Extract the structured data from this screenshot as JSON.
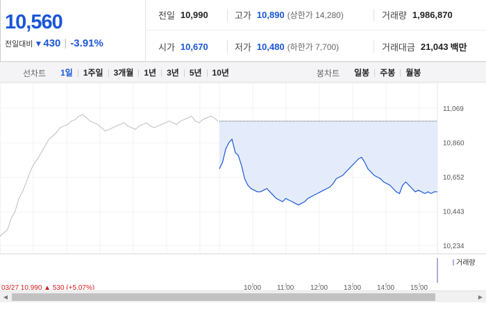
{
  "summary": {
    "price": "10,560",
    "change_label": "전일대비",
    "change_direction_icon": "down-triangle-icon",
    "change_value": "430",
    "change_percent": "-3.91%",
    "stats": {
      "prev_close": {
        "label": "전일",
        "value": "10,990"
      },
      "high": {
        "label": "고가",
        "value": "10,890",
        "sub": "(상한가 14,280)"
      },
      "volume": {
        "label": "거래량",
        "value": "1,986,870"
      },
      "open": {
        "label": "시가",
        "value": "10,670"
      },
      "low": {
        "label": "저가",
        "value": "10,480",
        "sub": "(하한가 7,700)"
      },
      "amount": {
        "label": "거래대금",
        "value": "21,043",
        "unit": "백만"
      }
    }
  },
  "toolbar": {
    "line_chart": {
      "title": "선차트",
      "items": [
        "1일",
        "1주일",
        "3개월",
        "1년",
        "3년",
        "5년",
        "10년"
      ],
      "active": 0
    },
    "candle_chart": {
      "title": "봉차트",
      "items": [
        "일봉",
        "주봉",
        "월봉"
      ]
    }
  },
  "colors": {
    "up": "#d61c1c",
    "down": "#1a56d6",
    "prev_line": "#bdbdbd",
    "fill": "#e4ecfb",
    "line": "#1a56d6"
  },
  "chart_data": {
    "type": "line",
    "y_ticks": [
      "11,069",
      "10,860",
      "10,652",
      "10,443",
      "10,234"
    ],
    "ylim": [
      10234,
      11069
    ],
    "volume_legend": "거래량",
    "x_ticks": [
      "10:00",
      "11:00",
      "12:00",
      "13:00",
      "14:00",
      "15:00"
    ],
    "prev_day_label": "03/27  10,990  ▲ 530 (+5.07%)",
    "series": [
      {
        "values": [
          10290,
          10310,
          10330,
          10400,
          10440,
          10520,
          10560,
          10620,
          10680,
          10730,
          10760,
          10800,
          10840,
          10880,
          10900,
          10920,
          10950,
          10960,
          10970,
          10990,
          11000,
          11020,
          11030,
          11010,
          10990,
          10980,
          10970,
          10950,
          10930,
          10940,
          10950,
          10960,
          10970,
          10980,
          10960,
          10950,
          10940,
          10960,
          10970,
          10980,
          10960,
          10950,
          10960,
          10970,
          10980,
          10990,
          10980,
          10970,
          10990,
          11000,
          11010,
          11020,
          10990,
          10980,
          11000,
          11010,
          11020,
          11010,
          10990
        ]
      },
      {
        "values": [
          10700,
          10740,
          10820,
          10860,
          10880,
          10800,
          10780,
          10720,
          10640,
          10600,
          10580,
          10570,
          10560,
          10560,
          10570,
          10580,
          10560,
          10540,
          10520,
          10510,
          10500,
          10520,
          10510,
          10500,
          10490,
          10480,
          10490,
          10500,
          10520,
          10530,
          10540,
          10550,
          10560,
          10570,
          10580,
          10590,
          10610,
          10640,
          10650,
          10660,
          10680,
          10700,
          10720,
          10740,
          10760,
          10770,
          10740,
          10700,
          10680,
          10660,
          10650,
          10640,
          10620,
          10610,
          10600,
          10580,
          10560,
          10550,
          10600,
          10620,
          10600,
          10580,
          10560,
          10570,
          10560,
          10550,
          10560,
          10550,
          10560,
          10560
        ]
      }
    ],
    "reference_line": 10990
  }
}
